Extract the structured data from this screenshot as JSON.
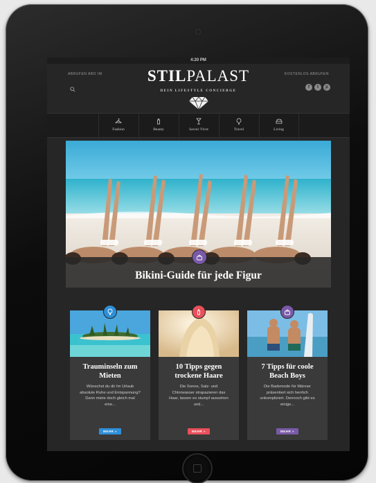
{
  "status_bar": {
    "time": "4:20 PM"
  },
  "header": {
    "left_link": "Abrufen Abo IM",
    "right_link": "Kostenlos Abrufen",
    "logo_bold": "STIL",
    "logo_light": "PALAST",
    "tagline": "DEIN LIFESTYLE CONCIERGE",
    "social": [
      "f",
      "t",
      "p"
    ]
  },
  "nav": {
    "items": [
      {
        "label": "Fashion",
        "icon": "hanger-icon"
      },
      {
        "label": "Beauty",
        "icon": "bottle-icon"
      },
      {
        "label": "Savoir Vivre",
        "icon": "glass-icon"
      },
      {
        "label": "Travel",
        "icon": "balloon-icon"
      },
      {
        "label": "Living",
        "icon": "sofa-icon"
      }
    ]
  },
  "hero": {
    "title": "Bikini-Guide für jede Figur",
    "badge_icon": "bag-icon",
    "badge_color": "#7a5aa8"
  },
  "cards": [
    {
      "title": "Trauminseln zum Mieten",
      "text": "Wünschst du dir Im Urlaub absolute Ruhe und Entspannung? Dann miete doch gleich mal eine...",
      "button": "MEHR »",
      "badge_icon": "balloon-icon",
      "color": "#2f8fd8"
    },
    {
      "title": "10 Tipps gegen trockene Haare",
      "text": "Die Sonne, Salz- und Chlorwasser strapazieren das Haar, lassen es stumpf aussehen und...",
      "button": "MEHR »",
      "badge_icon": "bottle-icon",
      "color": "#e8505b"
    },
    {
      "title": "7 Tipps für coole Beach Boys",
      "text": "Die Bademode für Männer präsentiert sich herrlich unkompliziert. Dennoch gibt es einige...",
      "button": "MEHR »",
      "badge_icon": "bag-icon",
      "color": "#7a5aa8"
    }
  ]
}
